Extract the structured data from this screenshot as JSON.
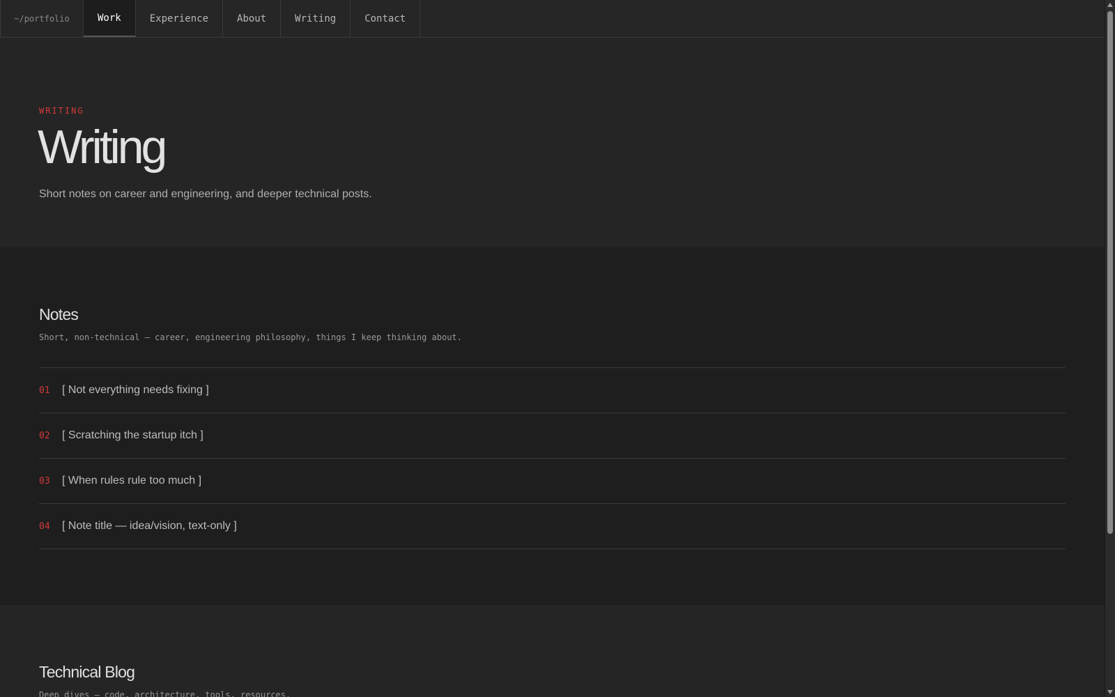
{
  "nav": {
    "brand": "~/portfolio",
    "items": [
      {
        "label": "Work",
        "active": true
      },
      {
        "label": "Experience",
        "active": false
      },
      {
        "label": "About",
        "active": false
      },
      {
        "label": "Writing",
        "active": false
      },
      {
        "label": "Contact",
        "active": false
      }
    ]
  },
  "hero": {
    "eyebrow": "WRITING",
    "title": "Writing",
    "subtitle": "Short notes on career and engineering, and deeper technical posts."
  },
  "notes": {
    "title": "Notes",
    "description": "Short, non-technical — career, engineering philosophy, things I keep thinking about.",
    "items": [
      {
        "num": "01",
        "title": "[ Not everything needs fixing ]"
      },
      {
        "num": "02",
        "title": "[ Scratching the startup itch ]"
      },
      {
        "num": "03",
        "title": "[ When rules rule too much ]"
      },
      {
        "num": "04",
        "title": "[ Note title — idea/vision, text-only ]"
      }
    ]
  },
  "blog": {
    "title": "Technical Blog",
    "description": "Deep dives — code, architecture, tools, resources."
  },
  "colors": {
    "accent": "#d33a3a",
    "background": "#252525",
    "section_background": "#1e1e1e"
  }
}
